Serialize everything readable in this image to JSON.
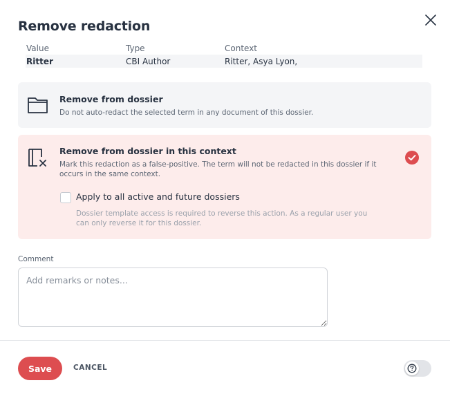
{
  "dialog": {
    "title": "Remove redaction"
  },
  "table": {
    "headers": [
      "Value",
      "Type",
      "Context"
    ],
    "row": [
      "Ritter",
      "CBI Author",
      "Ritter, Asya Lyon,"
    ]
  },
  "options": [
    {
      "icon": "folder-icon",
      "title": "Remove from dossier",
      "description": "Do not auto-redact the selected term in any document of this dossier.",
      "selected": false
    },
    {
      "icon": "remove-context-icon",
      "title": "Remove from dossier in this context",
      "description": "Mark this redaction as a false-positive. The term will not be redacted in this dossier if it occurs in the same context.",
      "selected": true,
      "checkbox_label": "Apply to all active and future dossiers",
      "checkbox_checked": false,
      "checkbox_note": "Dossier template access is required to reverse this action. As a regular user you can only reverse it for this dossier."
    }
  ],
  "comment": {
    "label": "Comment",
    "placeholder": "Add remarks or notes...",
    "value": ""
  },
  "footer": {
    "save_label": "Save",
    "cancel_label": "CANCEL",
    "help_icon": "help-icon",
    "help_toggle_on": false
  },
  "colors": {
    "accent": "#dd4d50",
    "selected_bg": "#fdeceb",
    "option_bg": "#f4f5f7",
    "text": "#283241"
  }
}
